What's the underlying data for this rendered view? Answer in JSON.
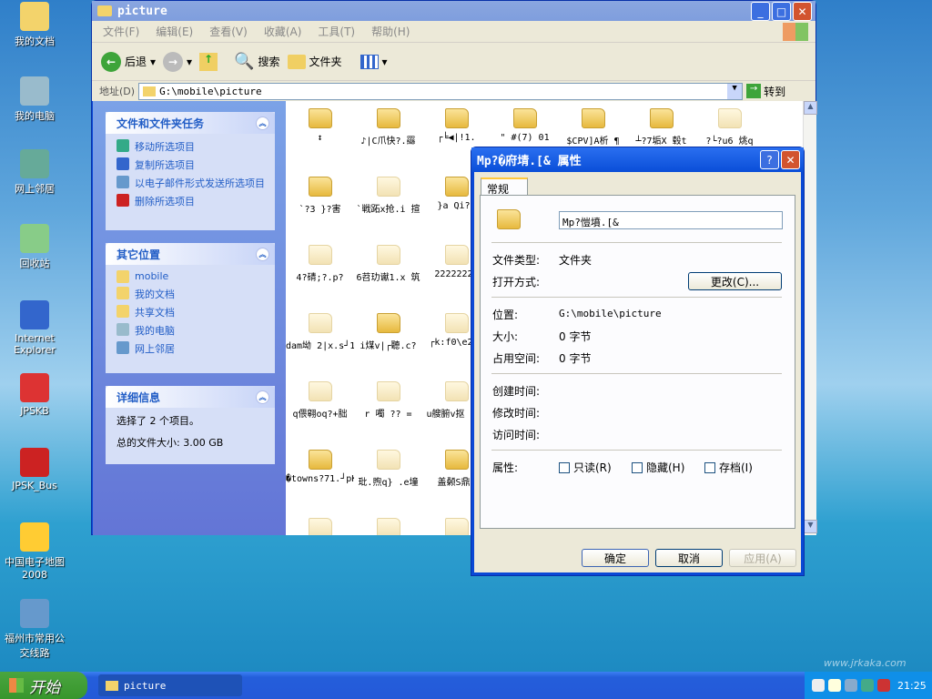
{
  "desktop": {
    "icons": [
      "我的文档",
      "我的电脑",
      "网上邻居",
      "回收站",
      "Internet Explorer",
      "JPSKB",
      "JPSK_Bus",
      "中国电子地图2008",
      "福州市常用公交线路"
    ]
  },
  "explorer": {
    "title": "picture",
    "menu": [
      "文件(F)",
      "编辑(E)",
      "查看(V)",
      "收藏(A)",
      "工具(T)",
      "帮助(H)"
    ],
    "toolbar": {
      "back": "后退",
      "search": "搜索",
      "folders": "文件夹"
    },
    "address": {
      "label": "地址(D)",
      "value": "G:\\mobile\\picture",
      "go": "转到"
    },
    "tasks": {
      "title": "文件和文件夹任务",
      "items": [
        "移动所选项目",
        "复制所选项目",
        "以电子邮件形式发送所选项目",
        "删除所选项目"
      ]
    },
    "places": {
      "title": "其它位置",
      "items": [
        "mobile",
        "我的文档",
        "共享文档",
        "我的电脑",
        "网上邻居"
      ]
    },
    "details": {
      "title": "详细信息",
      "selected": "选择了 2 个项目。",
      "total": "总的文件大小: 3.00 GB"
    },
    "rows": [
      [
        {
          "l": "↕"
        },
        {
          "l": "♪|C爪快?.羉"
        },
        {
          "l": "┌╘◀|!1."
        },
        {
          "l": "\" #(7)  01"
        },
        {
          "l": "$CPV]A析 ¶"
        },
        {
          "l": "┴?7垢X 毂t"
        },
        {
          "l": "?└?u6 烑q",
          "f": 1
        }
      ],
      [
        {
          "l": "`?3  }?害"
        },
        {
          "l": "`戦跖x抢.i 揎",
          "f": 1
        },
        {
          "l": "}a  Qi?."
        }
      ],
      [
        {
          "l": "4?碃;?.p?",
          "f": 1
        },
        {
          "l": "6苕玏谳1.x 筑",
          "f": 1
        },
        {
          "l": "22222222",
          "f": 1
        }
      ],
      [
        {
          "l": "dam坳 2|x.s┘1",
          "f": 1
        },
        {
          "l": "i煤v|┌聽.c?"
        },
        {
          "l": "┌k:f0\\e2 7",
          "f": 1
        }
      ],
      [
        {
          "l": "q偎翱oq?+朏",
          "f": 1
        },
        {
          "l": "r 噣 ??  =",
          "f": 1
        },
        {
          "l": "u艘腑v抠 59F",
          "f": 1
        }
      ],
      [
        {
          "l": "�towns?71.┘pK"
        },
        {
          "l": "玭.煦q} .e墥",
          "f": 1
        },
        {
          "l": "盖颡S鼎U"
        }
      ],
      [
        {
          "l": "",
          "f": 1
        },
        {
          "l": "",
          "f": 1
        },
        {
          "l": "",
          "f": 1
        }
      ]
    ]
  },
  "dialog": {
    "title": "Mp?�府埥.[& 属性",
    "tab": "常规",
    "name": "Mp?愷墳.[&",
    "type_label": "文件类型:",
    "type": "文件夹",
    "open_label": "打开方式:",
    "change": "更改(C)...",
    "loc_label": "位置:",
    "loc": "G:\\mobile\\picture",
    "size_label": "大小:",
    "size": "0 字节",
    "disk_label": "占用空间:",
    "disk": "0 字节",
    "created": "创建时间:",
    "modified": "修改时间:",
    "accessed": "访问时间:",
    "attr_label": "属性:",
    "readonly": "只读(R)",
    "hidden": "隐藏(H)",
    "archive": "存档(I)",
    "ok": "确定",
    "cancel": "取消",
    "apply": "应用(A)"
  },
  "taskbar": {
    "start": "开始",
    "task": "picture",
    "clock": "21:25",
    "watermark": "www.jrkaka.com"
  }
}
